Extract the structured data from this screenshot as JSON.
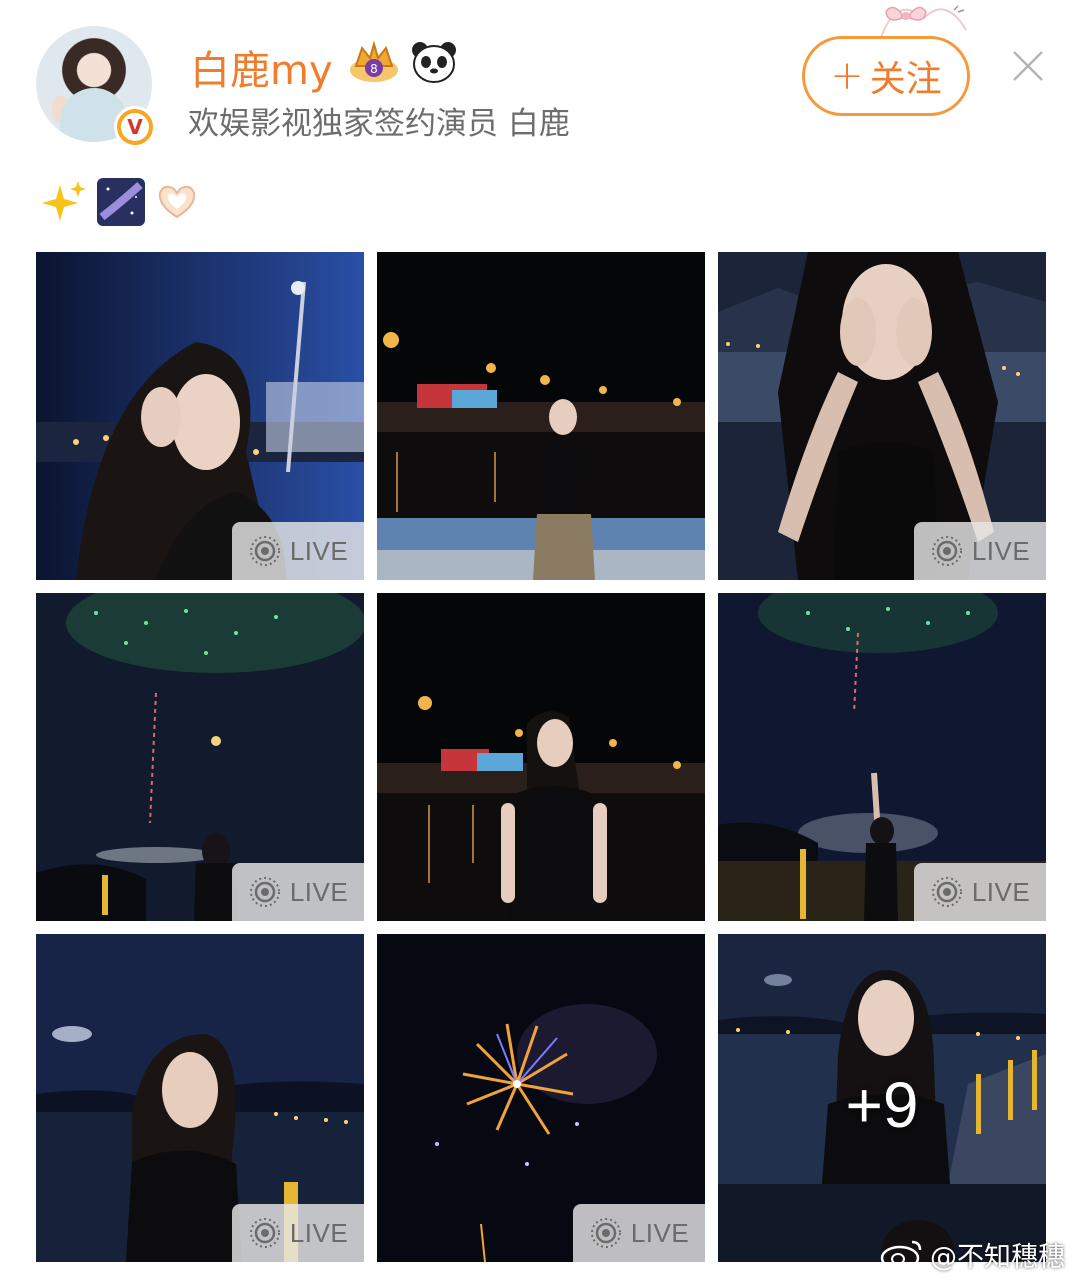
{
  "post": {
    "username": "白鹿my",
    "subtitle": "欢娱影视独家签约演员 白鹿",
    "follow_label": "关注",
    "follow_plus": "+",
    "verified_badge": "V",
    "emoji_text": [
      "sparkles-emoji",
      "galaxy-emoji",
      "heart-hands-emoji"
    ]
  },
  "grid": {
    "tiles": [
      {
        "name": "photo-1",
        "live": true
      },
      {
        "name": "photo-2",
        "live": false
      },
      {
        "name": "photo-3",
        "live": true
      },
      {
        "name": "photo-4",
        "live": true
      },
      {
        "name": "photo-5",
        "live": false
      },
      {
        "name": "photo-6",
        "live": true
      },
      {
        "name": "photo-7",
        "live": true
      },
      {
        "name": "photo-8",
        "live": true
      },
      {
        "name": "photo-9",
        "live": false
      }
    ],
    "live_label": "LIVE",
    "more_count": "+9"
  },
  "watermark": {
    "text": "@不知穗穗"
  },
  "colors": {
    "accent": "#f07c2e",
    "follow_border": "#f59a3c",
    "subtitle": "#6d6d6d"
  }
}
